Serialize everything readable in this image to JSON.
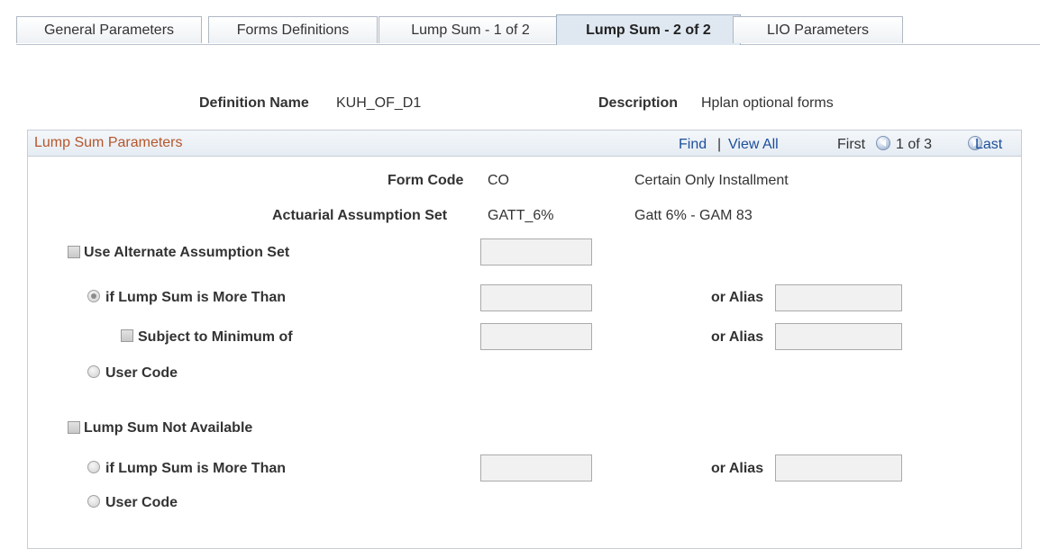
{
  "tabs": [
    {
      "label": "General Parameters",
      "active": false
    },
    {
      "label": "Forms Definitions",
      "active": false
    },
    {
      "label": "Lump Sum - 1 of 2",
      "active": false
    },
    {
      "label": "Lump Sum - 2 of 2",
      "active": true
    },
    {
      "label": "LIO Parameters",
      "active": false
    }
  ],
  "header": {
    "definition_name_label": "Definition Name",
    "definition_name_value": "KUH_OF_D1",
    "description_label": "Description",
    "description_value": "Hplan optional forms"
  },
  "grid": {
    "title": "Lump Sum Parameters",
    "find": "Find",
    "separator": "|",
    "view_all": "View All",
    "first": "First",
    "position": "1 of 3",
    "last": "Last"
  },
  "form": {
    "form_code_label": "Form Code",
    "form_code_value": "CO",
    "form_code_desc": "Certain Only Installment",
    "assumption_label": "Actuarial Assumption Set",
    "assumption_value": "GATT_6%",
    "assumption_desc": "Gatt 6% - GAM 83",
    "use_alternate_label": "Use Alternate Assumption Set",
    "if_more_than_label": "if Lump Sum is More Than",
    "or_alias": "or Alias",
    "subject_min_label": "Subject to Minimum of",
    "user_code_label": "User Code",
    "not_available_label": "Lump Sum Not Available",
    "if_more_than_label_2": "if Lump Sum is More Than",
    "user_code_label_2": "User Code"
  },
  "colors": {
    "title_accent": "#b5562b",
    "link": "#1c4e9a",
    "active_tab": "#dfe8f1"
  }
}
